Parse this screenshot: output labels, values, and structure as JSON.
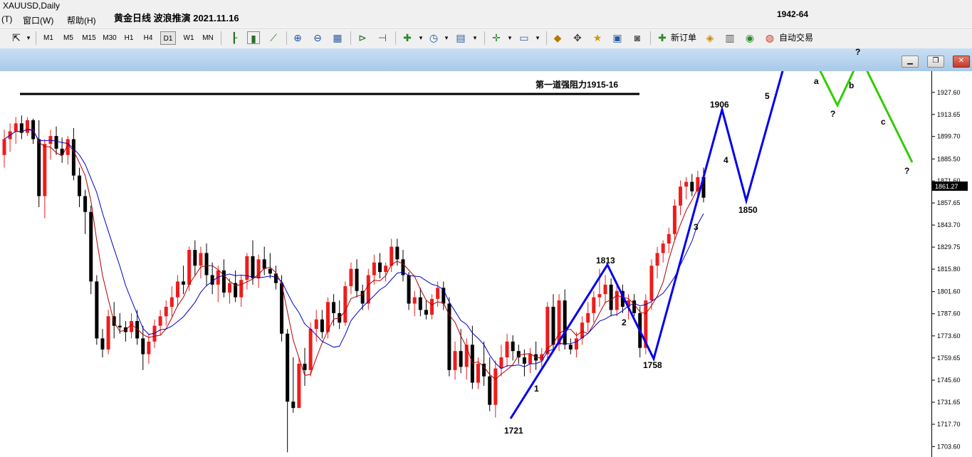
{
  "window": {
    "title": "XAUUSD,Daily"
  },
  "menu": [
    {
      "label": "(T)"
    },
    {
      "label": "窗口(W)"
    },
    {
      "label": "帮助(H)"
    }
  ],
  "doc_title": "黄金日线 波浪推演 2021.11.16",
  "toolbar": {
    "timeframes": [
      "M1",
      "M5",
      "M15",
      "M30",
      "H1",
      "H4",
      "D1",
      "W1",
      "MN"
    ],
    "active_timeframe": "D1",
    "new_order_label": "新订单",
    "auto_trade_label": "自动交易",
    "icons": [
      "cursor-icon",
      "bar-chart-icon",
      "candlestick-chart-icon",
      "line-chart-icon",
      "zoom-in-icon",
      "zoom-out-icon",
      "tile-windows-icon",
      "autoscroll-icon",
      "chart-shift-icon",
      "indicators-icon",
      "periods-icon",
      "templates-icon",
      "crosshair-add-icon",
      "objects-icon",
      "navigator-icon",
      "crosshair-icon",
      "market-watch-icon",
      "data-window-icon",
      "strategy-tester-icon",
      "metaeditor-icon",
      "options-icon",
      "signals-icon"
    ]
  },
  "chart_data": {
    "type": "candlestick",
    "symbol": "XAUUSD,Daily",
    "ylim": [
      1697,
      1941
    ],
    "y_ticks": [
      "1927.60",
      "1913.65",
      "1899.70",
      "1885.50",
      "1871.60",
      "1857.65",
      "1843.70",
      "1829.75",
      "1815.80",
      "1801.60",
      "1787.60",
      "1773.60",
      "1759.65",
      "1745.60",
      "1731.65",
      "1717.70",
      "1703.60"
    ],
    "current_price": "1861.27",
    "colors": {
      "up": "#ee1c1c",
      "down": "#000000",
      "ma_fast": "#b00000",
      "ma_slow": "#0000cc",
      "wave": "#0000ee",
      "correction": "#33cc00"
    },
    "candles": [
      {
        "o": 1888,
        "h": 1904,
        "l": 1880,
        "c": 1898
      },
      {
        "o": 1898,
        "h": 1908,
        "l": 1890,
        "c": 1903
      },
      {
        "o": 1903,
        "h": 1912,
        "l": 1895,
        "c": 1908
      },
      {
        "o": 1908,
        "h": 1913,
        "l": 1898,
        "c": 1902
      },
      {
        "o": 1902,
        "h": 1912,
        "l": 1900,
        "c": 1910
      },
      {
        "o": 1910,
        "h": 1911,
        "l": 1895,
        "c": 1898
      },
      {
        "o": 1898,
        "h": 1910,
        "l": 1855,
        "c": 1862
      },
      {
        "o": 1862,
        "h": 1898,
        "l": 1848,
        "c": 1895
      },
      {
        "o": 1895,
        "h": 1904,
        "l": 1885,
        "c": 1900
      },
      {
        "o": 1900,
        "h": 1906,
        "l": 1888,
        "c": 1892
      },
      {
        "o": 1892,
        "h": 1899,
        "l": 1883,
        "c": 1888
      },
      {
        "o": 1888,
        "h": 1900,
        "l": 1882,
        "c": 1898
      },
      {
        "o": 1898,
        "h": 1905,
        "l": 1872,
        "c": 1875
      },
      {
        "o": 1875,
        "h": 1880,
        "l": 1855,
        "c": 1862
      },
      {
        "o": 1862,
        "h": 1866,
        "l": 1838,
        "c": 1852
      },
      {
        "o": 1852,
        "h": 1856,
        "l": 1800,
        "c": 1808
      },
      {
        "o": 1808,
        "h": 1812,
        "l": 1768,
        "c": 1772
      },
      {
        "o": 1772,
        "h": 1778,
        "l": 1760,
        "c": 1765
      },
      {
        "o": 1765,
        "h": 1790,
        "l": 1762,
        "c": 1786
      },
      {
        "o": 1786,
        "h": 1795,
        "l": 1772,
        "c": 1780
      },
      {
        "o": 1780,
        "h": 1788,
        "l": 1775,
        "c": 1779
      },
      {
        "o": 1779,
        "h": 1783,
        "l": 1770,
        "c": 1776
      },
      {
        "o": 1776,
        "h": 1788,
        "l": 1772,
        "c": 1783
      },
      {
        "o": 1783,
        "h": 1790,
        "l": 1768,
        "c": 1772
      },
      {
        "o": 1772,
        "h": 1780,
        "l": 1752,
        "c": 1762
      },
      {
        "o": 1762,
        "h": 1775,
        "l": 1756,
        "c": 1770
      },
      {
        "o": 1770,
        "h": 1784,
        "l": 1766,
        "c": 1780
      },
      {
        "o": 1780,
        "h": 1790,
        "l": 1774,
        "c": 1786
      },
      {
        "o": 1786,
        "h": 1796,
        "l": 1780,
        "c": 1792
      },
      {
        "o": 1792,
        "h": 1805,
        "l": 1786,
        "c": 1798
      },
      {
        "o": 1798,
        "h": 1812,
        "l": 1792,
        "c": 1808
      },
      {
        "o": 1808,
        "h": 1818,
        "l": 1800,
        "c": 1806
      },
      {
        "o": 1806,
        "h": 1830,
        "l": 1802,
        "c": 1828
      },
      {
        "o": 1828,
        "h": 1834,
        "l": 1812,
        "c": 1818
      },
      {
        "o": 1818,
        "h": 1830,
        "l": 1810,
        "c": 1826
      },
      {
        "o": 1826,
        "h": 1832,
        "l": 1805,
        "c": 1812
      },
      {
        "o": 1812,
        "h": 1820,
        "l": 1800,
        "c": 1806
      },
      {
        "o": 1806,
        "h": 1818,
        "l": 1795,
        "c": 1815
      },
      {
        "o": 1815,
        "h": 1822,
        "l": 1798,
        "c": 1801
      },
      {
        "o": 1801,
        "h": 1810,
        "l": 1794,
        "c": 1807
      },
      {
        "o": 1807,
        "h": 1815,
        "l": 1795,
        "c": 1798
      },
      {
        "o": 1798,
        "h": 1812,
        "l": 1792,
        "c": 1809
      },
      {
        "o": 1809,
        "h": 1826,
        "l": 1803,
        "c": 1824
      },
      {
        "o": 1824,
        "h": 1834,
        "l": 1806,
        "c": 1810
      },
      {
        "o": 1810,
        "h": 1825,
        "l": 1804,
        "c": 1822
      },
      {
        "o": 1822,
        "h": 1830,
        "l": 1812,
        "c": 1816
      },
      {
        "o": 1816,
        "h": 1826,
        "l": 1810,
        "c": 1813
      },
      {
        "o": 1813,
        "h": 1818,
        "l": 1803,
        "c": 1807
      },
      {
        "o": 1807,
        "h": 1812,
        "l": 1770,
        "c": 1775
      },
      {
        "o": 1775,
        "h": 1778,
        "l": 1700,
        "c": 1732
      },
      {
        "o": 1732,
        "h": 1760,
        "l": 1725,
        "c": 1728
      },
      {
        "o": 1728,
        "h": 1760,
        "l": 1728,
        "c": 1756
      },
      {
        "o": 1756,
        "h": 1766,
        "l": 1742,
        "c": 1752
      },
      {
        "o": 1752,
        "h": 1782,
        "l": 1748,
        "c": 1778
      },
      {
        "o": 1778,
        "h": 1790,
        "l": 1770,
        "c": 1784
      },
      {
        "o": 1784,
        "h": 1790,
        "l": 1772,
        "c": 1776
      },
      {
        "o": 1776,
        "h": 1798,
        "l": 1772,
        "c": 1795
      },
      {
        "o": 1795,
        "h": 1800,
        "l": 1780,
        "c": 1788
      },
      {
        "o": 1788,
        "h": 1796,
        "l": 1778,
        "c": 1782
      },
      {
        "o": 1782,
        "h": 1808,
        "l": 1780,
        "c": 1805
      },
      {
        "o": 1805,
        "h": 1820,
        "l": 1800,
        "c": 1816
      },
      {
        "o": 1816,
        "h": 1822,
        "l": 1798,
        "c": 1802
      },
      {
        "o": 1802,
        "h": 1806,
        "l": 1790,
        "c": 1794
      },
      {
        "o": 1794,
        "h": 1816,
        "l": 1790,
        "c": 1812
      },
      {
        "o": 1812,
        "h": 1825,
        "l": 1806,
        "c": 1820
      },
      {
        "o": 1820,
        "h": 1826,
        "l": 1810,
        "c": 1814
      },
      {
        "o": 1814,
        "h": 1820,
        "l": 1808,
        "c": 1818
      },
      {
        "o": 1818,
        "h": 1835,
        "l": 1814,
        "c": 1830
      },
      {
        "o": 1830,
        "h": 1835,
        "l": 1818,
        "c": 1822
      },
      {
        "o": 1822,
        "h": 1828,
        "l": 1808,
        "c": 1812
      },
      {
        "o": 1812,
        "h": 1814,
        "l": 1790,
        "c": 1794
      },
      {
        "o": 1794,
        "h": 1802,
        "l": 1786,
        "c": 1798
      },
      {
        "o": 1798,
        "h": 1804,
        "l": 1786,
        "c": 1790
      },
      {
        "o": 1790,
        "h": 1796,
        "l": 1784,
        "c": 1787
      },
      {
        "o": 1787,
        "h": 1800,
        "l": 1784,
        "c": 1797
      },
      {
        "o": 1797,
        "h": 1808,
        "l": 1792,
        "c": 1804
      },
      {
        "o": 1804,
        "h": 1808,
        "l": 1790,
        "c": 1794
      },
      {
        "o": 1794,
        "h": 1798,
        "l": 1748,
        "c": 1752
      },
      {
        "o": 1752,
        "h": 1770,
        "l": 1746,
        "c": 1764
      },
      {
        "o": 1764,
        "h": 1778,
        "l": 1750,
        "c": 1754
      },
      {
        "o": 1754,
        "h": 1772,
        "l": 1746,
        "c": 1768
      },
      {
        "o": 1768,
        "h": 1780,
        "l": 1740,
        "c": 1744
      },
      {
        "o": 1744,
        "h": 1760,
        "l": 1740,
        "c": 1756
      },
      {
        "o": 1756,
        "h": 1770,
        "l": 1742,
        "c": 1748
      },
      {
        "o": 1748,
        "h": 1760,
        "l": 1726,
        "c": 1730
      },
      {
        "o": 1730,
        "h": 1758,
        "l": 1722,
        "c": 1753
      },
      {
        "o": 1753,
        "h": 1768,
        "l": 1748,
        "c": 1760
      },
      {
        "o": 1760,
        "h": 1775,
        "l": 1754,
        "c": 1770
      },
      {
        "o": 1770,
        "h": 1774,
        "l": 1758,
        "c": 1764
      },
      {
        "o": 1764,
        "h": 1768,
        "l": 1756,
        "c": 1760
      },
      {
        "o": 1760,
        "h": 1765,
        "l": 1748,
        "c": 1756
      },
      {
        "o": 1756,
        "h": 1766,
        "l": 1750,
        "c": 1762
      },
      {
        "o": 1762,
        "h": 1770,
        "l": 1752,
        "c": 1758
      },
      {
        "o": 1758,
        "h": 1766,
        "l": 1754,
        "c": 1762
      },
      {
        "o": 1762,
        "h": 1795,
        "l": 1758,
        "c": 1792
      },
      {
        "o": 1792,
        "h": 1800,
        "l": 1765,
        "c": 1768
      },
      {
        "o": 1768,
        "h": 1800,
        "l": 1764,
        "c": 1796
      },
      {
        "o": 1796,
        "h": 1803,
        "l": 1765,
        "c": 1768
      },
      {
        "o": 1768,
        "h": 1772,
        "l": 1762,
        "c": 1765
      },
      {
        "o": 1765,
        "h": 1776,
        "l": 1760,
        "c": 1772
      },
      {
        "o": 1772,
        "h": 1786,
        "l": 1768,
        "c": 1782
      },
      {
        "o": 1782,
        "h": 1795,
        "l": 1776,
        "c": 1788
      },
      {
        "o": 1788,
        "h": 1802,
        "l": 1782,
        "c": 1798
      },
      {
        "o": 1798,
        "h": 1816,
        "l": 1792,
        "c": 1800
      },
      {
        "o": 1800,
        "h": 1812,
        "l": 1794,
        "c": 1806
      },
      {
        "o": 1806,
        "h": 1810,
        "l": 1786,
        "c": 1790
      },
      {
        "o": 1790,
        "h": 1806,
        "l": 1786,
        "c": 1802
      },
      {
        "o": 1802,
        "h": 1806,
        "l": 1788,
        "c": 1792
      },
      {
        "o": 1792,
        "h": 1800,
        "l": 1784,
        "c": 1796
      },
      {
        "o": 1796,
        "h": 1800,
        "l": 1786,
        "c": 1788
      },
      {
        "o": 1788,
        "h": 1792,
        "l": 1760,
        "c": 1766
      },
      {
        "o": 1766,
        "h": 1800,
        "l": 1762,
        "c": 1796
      },
      {
        "o": 1796,
        "h": 1822,
        "l": 1790,
        "c": 1818
      },
      {
        "o": 1818,
        "h": 1830,
        "l": 1810,
        "c": 1826
      },
      {
        "o": 1826,
        "h": 1834,
        "l": 1820,
        "c": 1832
      },
      {
        "o": 1832,
        "h": 1842,
        "l": 1826,
        "c": 1838
      },
      {
        "o": 1838,
        "h": 1860,
        "l": 1834,
        "c": 1856
      },
      {
        "o": 1856,
        "h": 1872,
        "l": 1850,
        "c": 1868
      },
      {
        "o": 1868,
        "h": 1874,
        "l": 1860,
        "c": 1871
      },
      {
        "o": 1871,
        "h": 1876,
        "l": 1862,
        "c": 1865
      },
      {
        "o": 1865,
        "h": 1878,
        "l": 1858,
        "c": 1874
      },
      {
        "o": 1874,
        "h": 1880,
        "l": 1858,
        "c": 1861
      }
    ],
    "levels": [
      {
        "price": 1917.5,
        "label": "第一道强阻力1915-16"
      }
    ],
    "wave_labels": [
      "1721",
      "1",
      "1813",
      "2",
      "1758",
      "3",
      "1906",
      "4",
      "1850",
      "5",
      "1942-64",
      "a",
      "b",
      "c"
    ],
    "question_labels": [
      "?",
      "?",
      "?"
    ]
  }
}
